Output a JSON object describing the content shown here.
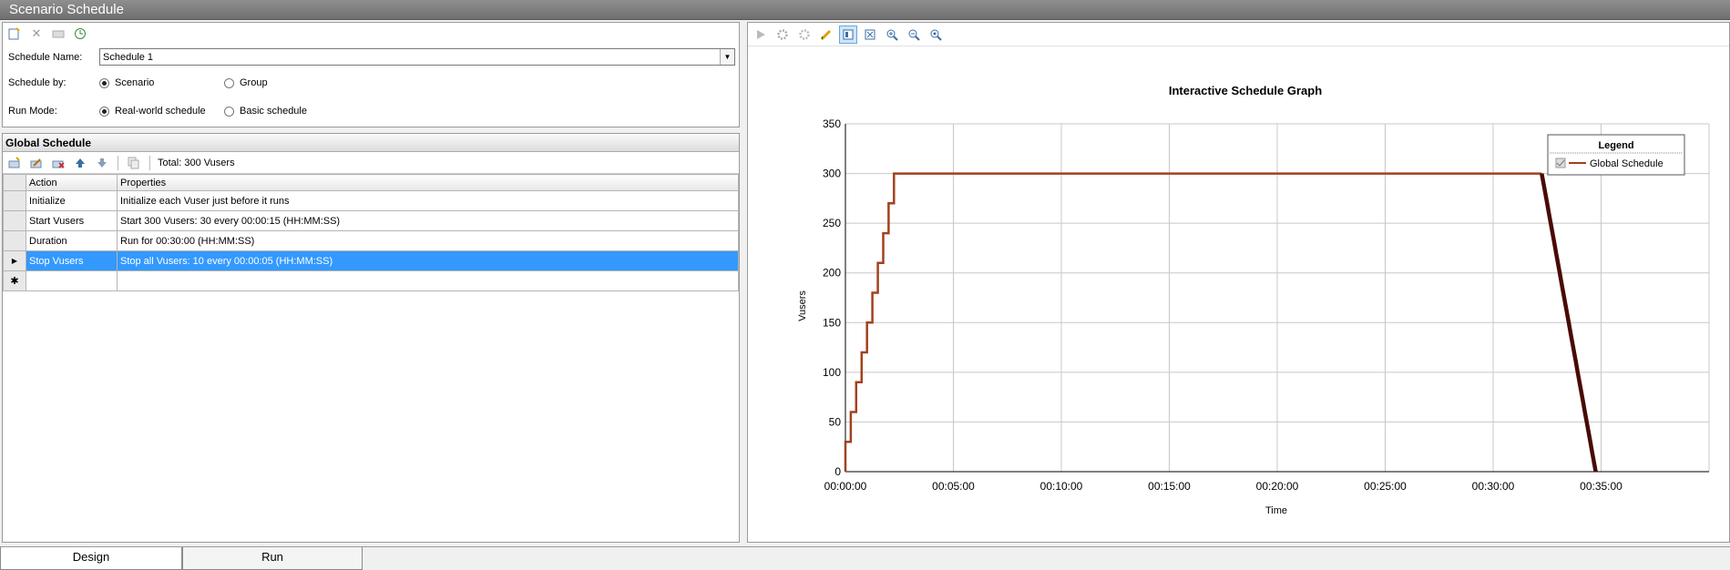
{
  "window": {
    "title": "Scenario Schedule"
  },
  "schedule": {
    "name_label": "Schedule Name:",
    "name_value": "Schedule 1",
    "by_label": "Schedule by:",
    "by_options": [
      "Scenario",
      "Group"
    ],
    "by_selected": "Scenario",
    "mode_label": "Run Mode:",
    "mode_options": [
      "Real-world schedule",
      "Basic schedule"
    ],
    "mode_selected": "Real-world schedule"
  },
  "global": {
    "header": "Global Schedule",
    "total": "Total: 300 Vusers",
    "columns": [
      "Action",
      "Properties"
    ],
    "rows": [
      {
        "action": "Initialize",
        "properties": "Initialize each Vuser just before it runs"
      },
      {
        "action": "Start  Vusers",
        "properties": "Start 300 Vusers: 30 every 00:00:15 (HH:MM:SS)"
      },
      {
        "action": "Duration",
        "properties": "Run for 00:30:00 (HH:MM:SS)"
      },
      {
        "action": "Stop Vusers",
        "properties": "Stop all Vusers: 10 every 00:00:05 (HH:MM:SS)"
      }
    ],
    "selected_row": 3,
    "new_row_marker": "✱",
    "current_row_marker": "▶"
  },
  "icons": {
    "schedule_toolbar": [
      "new-schedule-icon",
      "delete-icon",
      "rename-icon",
      "schedule-clock-icon"
    ],
    "grid_toolbar": [
      "add-action-icon",
      "edit-action-icon",
      "delete-action-icon",
      "move-up-icon",
      "move-down-icon",
      "copy-icon"
    ],
    "graph_toolbar": [
      "play-icon",
      "gear-icon",
      "cogs-icon",
      "pencil-icon",
      "view-icon",
      "fit-icon",
      "zoom-in-icon",
      "zoom-out-icon",
      "zoom-reset-icon"
    ]
  },
  "colors": {
    "line": "#a0421e",
    "stop_line": "#4a0a06",
    "selection": "#3399ff"
  },
  "chart_data": {
    "type": "line",
    "title": "Interactive Schedule Graph",
    "xlabel": "Time",
    "ylabel": "Vusers",
    "xticks": [
      "00:00:00",
      "00:05:00",
      "00:10:00",
      "00:15:00",
      "00:20:00",
      "00:25:00",
      "00:30:00",
      "00:35:00"
    ],
    "xlim_minutes": [
      0,
      40
    ],
    "ylim": [
      0,
      350
    ],
    "yticks": [
      0,
      50,
      100,
      150,
      200,
      250,
      300,
      350
    ],
    "grid": true,
    "legend": {
      "title": "Legend",
      "placement": "top-right",
      "entries": [
        "Global Schedule"
      ]
    },
    "series": [
      {
        "name": "Global Schedule",
        "step_points_minutes": [
          [
            0,
            0
          ],
          [
            0,
            30
          ],
          [
            0.25,
            30
          ],
          [
            0.25,
            60
          ],
          [
            0.5,
            60
          ],
          [
            0.5,
            90
          ],
          [
            0.75,
            90
          ],
          [
            0.75,
            120
          ],
          [
            1.0,
            120
          ],
          [
            1.0,
            150
          ],
          [
            1.25,
            150
          ],
          [
            1.25,
            180
          ],
          [
            1.5,
            180
          ],
          [
            1.5,
            210
          ],
          [
            1.75,
            210
          ],
          [
            1.75,
            240
          ],
          [
            2.0,
            240
          ],
          [
            2.0,
            270
          ],
          [
            2.25,
            270
          ],
          [
            2.25,
            300
          ],
          [
            32.25,
            300
          ]
        ],
        "stop_segment_minutes": [
          [
            32.25,
            300
          ],
          [
            34.75,
            0
          ]
        ]
      }
    ]
  },
  "tabs": [
    "Design",
    "Run"
  ],
  "active_tab": "Design"
}
